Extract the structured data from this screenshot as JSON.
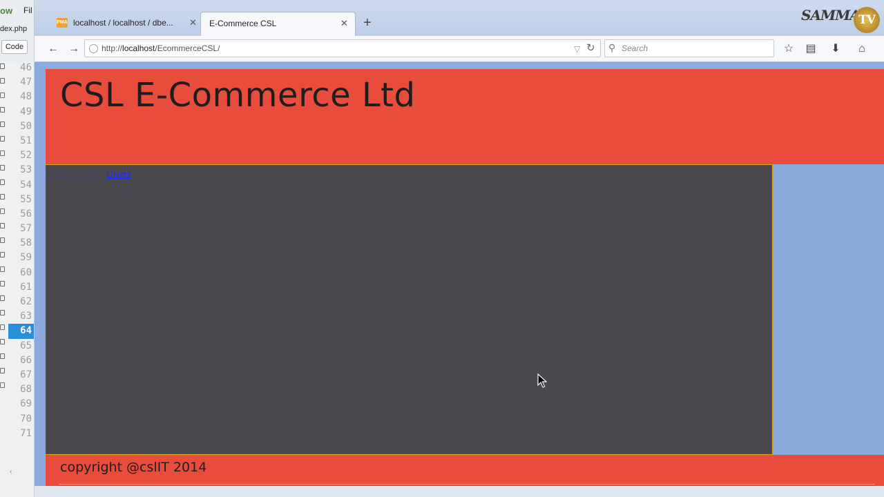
{
  "editor": {
    "menu_a": "ow",
    "menu_b": "Fil",
    "file_name": "dex.php",
    "code_button": "Code",
    "line_numbers": [
      "46",
      "47",
      "48",
      "49",
      "50",
      "51",
      "52",
      "53",
      "54",
      "55",
      "56",
      "57",
      "58",
      "59",
      "60",
      "61",
      "62",
      "63",
      "64",
      "65",
      "66",
      "67",
      "68",
      "69",
      "70",
      "71"
    ],
    "active_line": "64"
  },
  "browser": {
    "tabs": [
      {
        "title": "localhost / localhost / dbe...",
        "favicon": "PMA",
        "active": false
      },
      {
        "title": "E-Commerce CSL",
        "active": true
      }
    ],
    "new_tab_label": "+",
    "url": {
      "prefix": "http://",
      "host": "localhost",
      "path": "/EcommerceCSL/"
    },
    "search_placeholder": "Search",
    "watermark": {
      "text": "SAMMAR",
      "badge": "TV"
    }
  },
  "page": {
    "title": "CSL E-Commerce Ltd",
    "nav": {
      "country_city": "Country-City",
      "users": "Users"
    },
    "footer": "copyright @cslIT 2014"
  },
  "colors": {
    "header_bg": "#e74c3c",
    "content_bg": "#4a494e",
    "page_bg": "#8aaadd",
    "link": "#1a2cff",
    "active_line": "#2a8fd8"
  },
  "icons": [
    "back-arrow-icon",
    "forward-arrow-icon",
    "globe-icon",
    "reload-icon",
    "search-icon",
    "bookmark-star-icon",
    "reading-list-icon",
    "download-icon",
    "home-icon",
    "close-icon",
    "mouse-cursor-icon"
  ]
}
